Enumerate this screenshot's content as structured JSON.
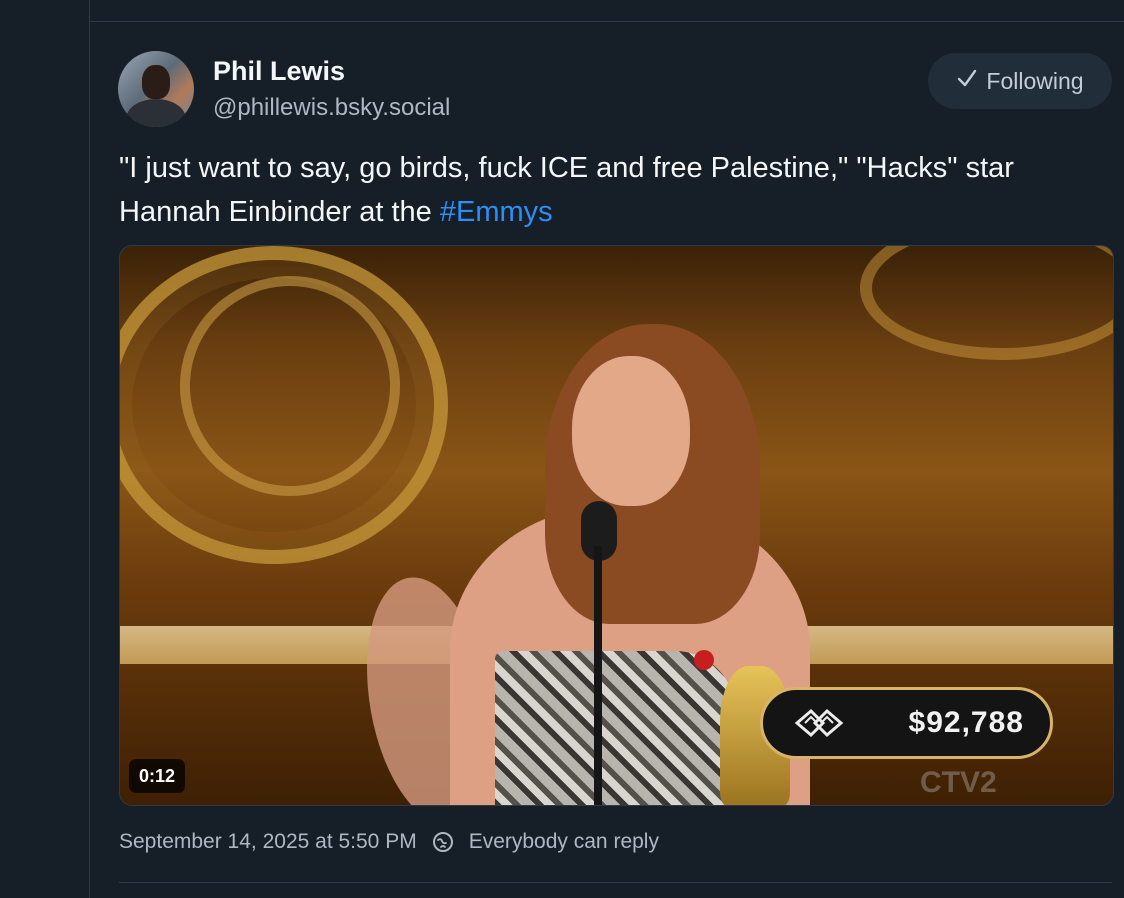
{
  "post": {
    "author": {
      "display_name": "Phil Lewis",
      "handle": "@phillewis.bsky.social"
    },
    "follow_button": {
      "label": "Following",
      "icon": "check-icon"
    },
    "text_before_hashtag": "\"I just want to say, go birds, fuck ICE and free Palestine,\" \"Hacks\" star Hannah Einbinder at the ",
    "hashtag": "#Emmys",
    "media": {
      "duration": "0:12",
      "overlay_amount": "$92,788",
      "overlay_logo": "boys-girls-club-logo-icon",
      "channel_watermark": "CTV2"
    },
    "timestamp": "September 14, 2025 at 5:50 PM",
    "reply_setting": "Everybody can reply",
    "reply_icon": "globe-icon"
  },
  "colors": {
    "background": "#161e27",
    "link": "#2d8ef5",
    "secondary_text": "#aeb8c3"
  }
}
